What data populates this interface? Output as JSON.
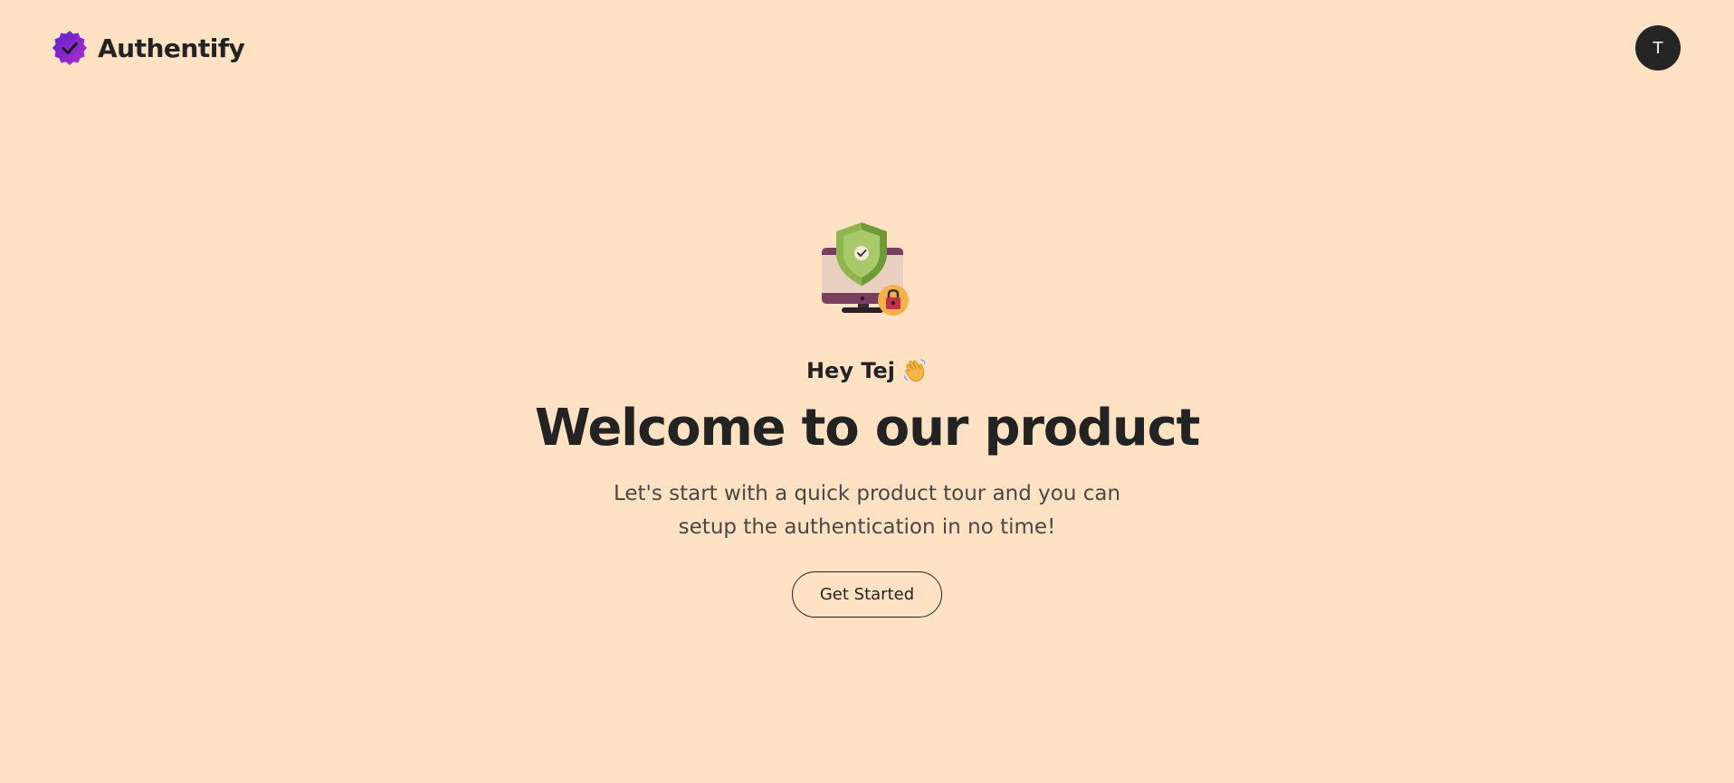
{
  "header": {
    "brand_name": "Authentify",
    "logo_icon": "verified-badge-icon",
    "avatar_initial": "T"
  },
  "hero": {
    "illustration_icon": "secure-computer-shield-icon",
    "greeting": "Hey Tej",
    "greeting_icon": "waving-hand-icon",
    "title": "Welcome to our product",
    "subtitle": "Let's start with a quick product tour and you can setup the authentication in no time!",
    "cta_label": "Get Started"
  },
  "colors": {
    "background": "#ffe2c4",
    "text": "#232323",
    "brand_purple": "#7b2fd9",
    "avatar_bg": "#252525"
  }
}
